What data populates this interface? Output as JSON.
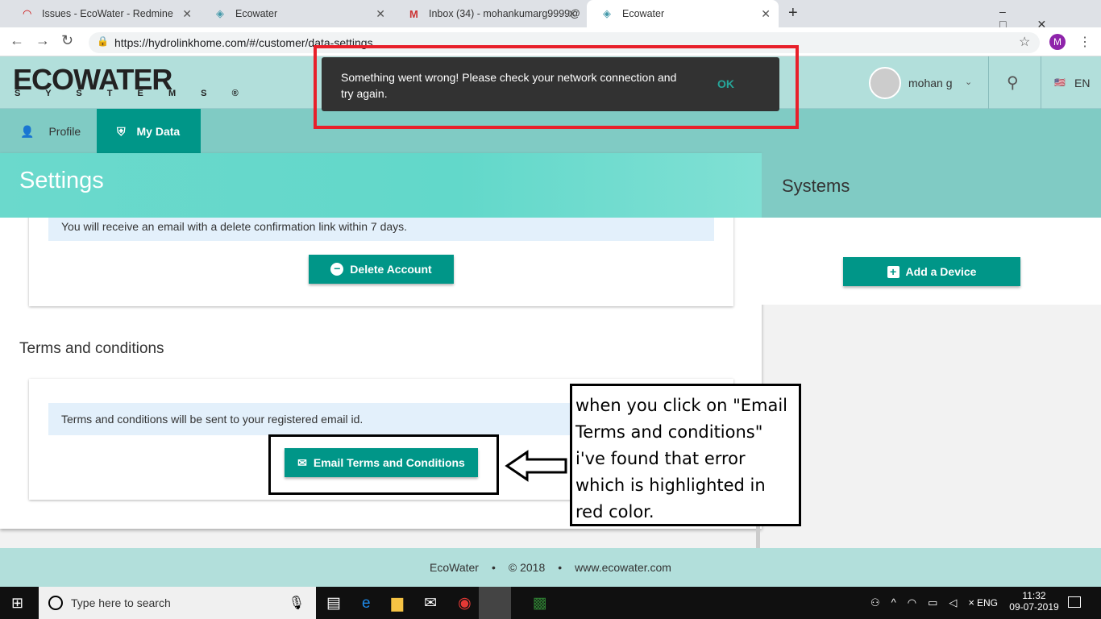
{
  "browser": {
    "tabs": [
      {
        "title": "Issues - EcoWater - Redmine"
      },
      {
        "title": "Ecowater"
      },
      {
        "title": "Inbox (34) - mohankumarg9999@"
      },
      {
        "title": "Ecowater"
      }
    ],
    "new_tab": "+",
    "url": "https://hydrolinkhome.com/#/customer/data-settings",
    "profile_initial": "M"
  },
  "header": {
    "logo_main": "ECOWATER",
    "logo_sub": "S Y S T E M S ®",
    "user": "mohan g",
    "language": "EN"
  },
  "nav": {
    "items": [
      {
        "label": "Profile"
      },
      {
        "label": "My Data"
      }
    ]
  },
  "toast": {
    "message": "Something went wrong! Please check your network connection and try again.",
    "action": "OK"
  },
  "settings": {
    "title": "Settings",
    "delete_info": "You will receive an email with a delete confirmation link within 7 days.",
    "delete_button": "Delete Account",
    "terms_heading": "Terms and conditions",
    "terms_info": "Terms and conditions will be sent to your registered email id.",
    "terms_button": "Email Terms and Conditions"
  },
  "systems": {
    "title": "Systems",
    "add_button": "Add a Device"
  },
  "footer": {
    "brand": "EcoWater",
    "copyright": "© 2018",
    "site": "www.ecowater.com",
    "sep": "•"
  },
  "annotation": {
    "text": "when you click on \"Email Terms and conditions\" i've found that error which is highlighted in red color."
  },
  "taskbar": {
    "search_placeholder": "Type here to search",
    "lang": "ENG",
    "time": "11:32",
    "date": "09-07-2019"
  },
  "colors": {
    "accent": "#009688",
    "highlight": "#e8202a"
  }
}
